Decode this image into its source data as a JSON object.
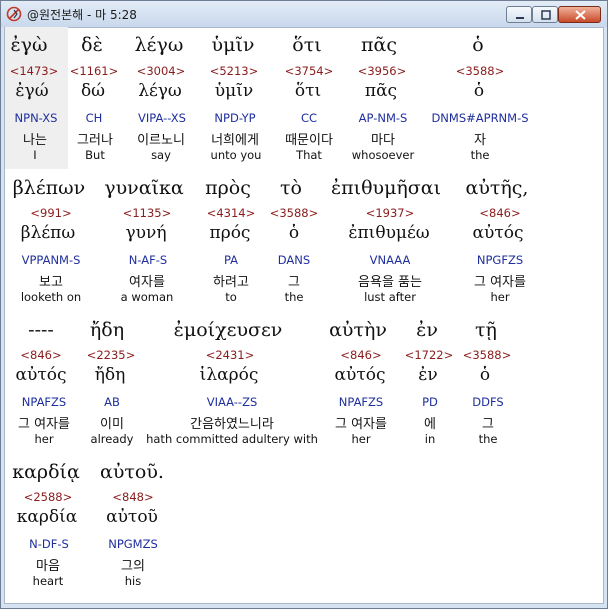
{
  "window": {
    "title": "@원전본해 - 마 5:28",
    "buttons": [
      "minimize",
      "maximize",
      "close"
    ]
  },
  "rows": [
    {
      "greek_line": [
        "ἐγὼ",
        "δὲ",
        "λέγω",
        "ὑμῖν",
        "ὅτι",
        "πᾶς",
        "ὁ"
      ],
      "words": [
        {
          "num": "<1473>",
          "lemma": "ἐγώ",
          "morph": "NPN-XS",
          "korean": "나는",
          "english": "I"
        },
        {
          "num": "<1161>",
          "lemma": "δώ",
          "morph": "CH",
          "korean": "그러나",
          "english": "But"
        },
        {
          "num": "<3004>",
          "lemma": "λέγω",
          "morph": "VIPA--XS",
          "korean": "이르노니",
          "english": "say"
        },
        {
          "num": "<5213>",
          "lemma": "ὑμῖν",
          "morph": "NPD-YP",
          "korean": "너희에게",
          "english": "unto you"
        },
        {
          "num": "<3754>",
          "lemma": "ὅτι",
          "morph": "CC",
          "korean": "때문이다",
          "english": "That"
        },
        {
          "num": "<3956>",
          "lemma": "πᾶς",
          "morph": "AP-NM-S",
          "korean": "마다",
          "english": "whosoever"
        },
        {
          "num": "<3588>",
          "lemma": "ὁ",
          "morph": "DNMS#APRNM-S",
          "korean": "자",
          "english": "the"
        }
      ]
    },
    {
      "greek_line": [
        "βλέπων",
        "γυναῖκα",
        "πρὸς",
        "τὸ",
        "ἐπιθυμῆσαι",
        "αὐτῆς,"
      ],
      "words": [
        {
          "num": "<991>",
          "lemma": "βλέπω",
          "morph": "VPPANM-S",
          "korean": "보고",
          "english": "looketh on"
        },
        {
          "num": "<1135>",
          "lemma": "γυνή",
          "morph": "N-AF-S",
          "korean": "여자를",
          "english": "a woman"
        },
        {
          "num": "<4314>",
          "lemma": "πρός",
          "morph": "PA",
          "korean": "하려고",
          "english": "to"
        },
        {
          "num": "<3588>",
          "lemma": "ὁ",
          "morph": "DANS",
          "korean": "그",
          "english": "the"
        },
        {
          "num": "<1937>",
          "lemma": "ἐπιθυμέω",
          "morph": "VNAAA",
          "korean": "음욕을 품는",
          "english": "lust after"
        },
        {
          "num": "<846>",
          "lemma": "αὐτός",
          "morph": "NPGFZS",
          "korean": "그 여자를",
          "english": "her"
        }
      ]
    },
    {
      "greek_line": [
        "----",
        "ἤδη",
        "ἐμοίχευσεν",
        "αὐτὴν",
        "ἐν",
        "τῇ"
      ],
      "words": [
        {
          "num": "<846>",
          "lemma": "αὐτός",
          "morph": "NPAFZS",
          "korean": "그 여자를",
          "english": "her"
        },
        {
          "num": "<2235>",
          "lemma": "ἤδη",
          "morph": "AB",
          "korean": "이미",
          "english": "already"
        },
        {
          "num": "<2431>",
          "lemma": "ἱλαρός",
          "morph": "VIAA--ZS",
          "korean": "간음하였느니라",
          "english": "hath committed adultery with"
        },
        {
          "num": "<846>",
          "lemma": "αὐτός",
          "morph": "NPAFZS",
          "korean": "그 여자를",
          "english": "her"
        },
        {
          "num": "<1722>",
          "lemma": "ἐν",
          "morph": "PD",
          "korean": "에",
          "english": "in"
        },
        {
          "num": "<3588>",
          "lemma": "ὁ",
          "morph": "DDFS",
          "korean": "그",
          "english": "the"
        }
      ]
    },
    {
      "greek_line": [
        "καρδίᾳ",
        "αὐτοῦ."
      ],
      "words": [
        {
          "num": "<2588>",
          "lemma": "καρδία",
          "morph": "N-DF-S",
          "korean": "마음",
          "english": "heart"
        },
        {
          "num": "<848>",
          "lemma": "αὐτοῦ",
          "morph": "NPGMZS",
          "korean": "그의",
          "english": "his"
        }
      ]
    }
  ]
}
